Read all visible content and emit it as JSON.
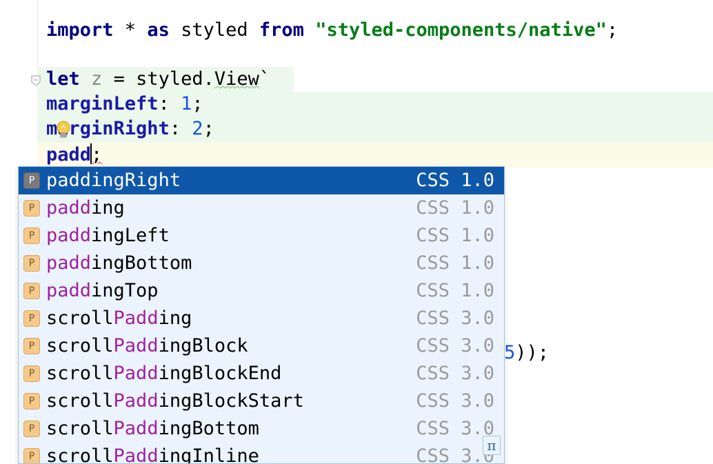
{
  "editor": {
    "line1": {
      "kw1": "import",
      "mid": " * ",
      "kw2": "as",
      "id": " styled ",
      "kw3": "from",
      "sp": " ",
      "str": "\"styled-components/native\"",
      "end": ";"
    },
    "line2": {
      "kw": "let",
      "sp": " ",
      "var": "z",
      "mid": " = styled.",
      "view": "View",
      "tick": "`"
    },
    "line3": {
      "prop": "marginLeft",
      "colon": ": ",
      "num": "1",
      "end": ";"
    },
    "line4": {
      "prop": "marginRight",
      "colon": ": ",
      "num": "2",
      "end": ";"
    },
    "line5": {
      "typed": "padd",
      "end": ";"
    },
    "line_hidden": {
      "num": "5",
      "end": "));"
    }
  },
  "completion": {
    "items": [
      {
        "match": "padd",
        "rest": "ingRight",
        "pre": "",
        "type": "CSS 1.0",
        "badge": "P"
      },
      {
        "match": "padd",
        "rest": "ing",
        "pre": "",
        "type": "CSS 1.0",
        "badge": "P"
      },
      {
        "match": "padd",
        "rest": "ingLeft",
        "pre": "",
        "type": "CSS 1.0",
        "badge": "P"
      },
      {
        "match": "padd",
        "rest": "ingBottom",
        "pre": "",
        "type": "CSS 1.0",
        "badge": "P"
      },
      {
        "match": "padd",
        "rest": "ingTop",
        "pre": "",
        "type": "CSS 1.0",
        "badge": "P"
      },
      {
        "pre": "scroll",
        "match": "Padd",
        "rest": "ing",
        "type": "CSS 3.0",
        "badge": "P"
      },
      {
        "pre": "scroll",
        "match": "Padd",
        "rest": "ingBlock",
        "type": "CSS 3.0",
        "badge": "P"
      },
      {
        "pre": "scroll",
        "match": "Padd",
        "rest": "ingBlockEnd",
        "type": "CSS 3.0",
        "badge": "P"
      },
      {
        "pre": "scroll",
        "match": "Padd",
        "rest": "ingBlockStart",
        "type": "CSS 3.0",
        "badge": "P"
      },
      {
        "pre": "scroll",
        "match": "Padd",
        "rest": "ingBottom",
        "type": "CSS 3.0",
        "badge": "P"
      },
      {
        "pre": "scroll",
        "match": "Padd",
        "rest": "ingInline",
        "type": "CSS 3.0",
        "badge": "P"
      }
    ],
    "pi_label": "π"
  }
}
